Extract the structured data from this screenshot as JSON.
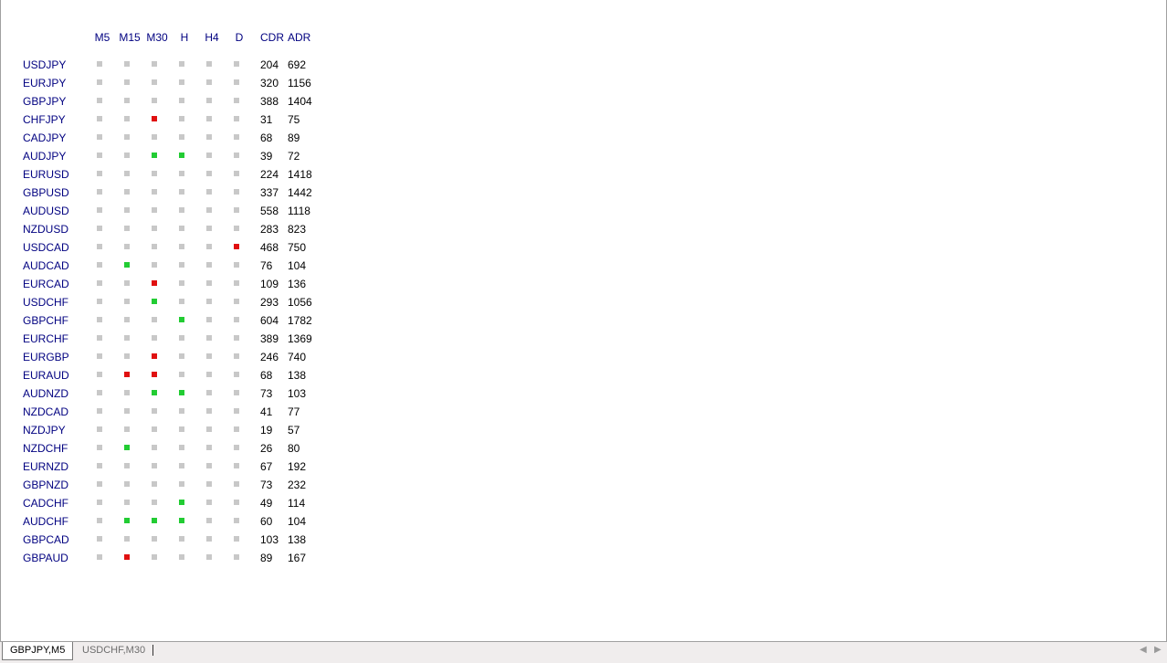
{
  "headers": {
    "timeframes": [
      "M5",
      "M15",
      "M30",
      "H",
      "H4",
      "D"
    ],
    "cdr": "CDR",
    "adr": "ADR"
  },
  "colors": {
    "grey": "#c8c8c8",
    "red": "#e01010",
    "green": "#22cc33"
  },
  "rows": [
    {
      "symbol": "USDJPY",
      "signals": [
        "g",
        "g",
        "g",
        "g",
        "g",
        "g"
      ],
      "cdr": "204",
      "adr": "692"
    },
    {
      "symbol": "EURJPY",
      "signals": [
        "g",
        "g",
        "g",
        "g",
        "g",
        "g"
      ],
      "cdr": "320",
      "adr": "1156"
    },
    {
      "symbol": "GBPJPY",
      "signals": [
        "g",
        "g",
        "g",
        "g",
        "g",
        "g"
      ],
      "cdr": "388",
      "adr": "1404"
    },
    {
      "symbol": "CHFJPY",
      "signals": [
        "g",
        "g",
        "r",
        "g",
        "g",
        "g"
      ],
      "cdr": "31",
      "adr": "75"
    },
    {
      "symbol": "CADJPY",
      "signals": [
        "g",
        "g",
        "g",
        "g",
        "g",
        "g"
      ],
      "cdr": "68",
      "adr": "89"
    },
    {
      "symbol": "AUDJPY",
      "signals": [
        "g",
        "g",
        "G",
        "G",
        "g",
        "g"
      ],
      "cdr": "39",
      "adr": "72"
    },
    {
      "symbol": "EURUSD",
      "signals": [
        "g",
        "g",
        "g",
        "g",
        "g",
        "g"
      ],
      "cdr": "224",
      "adr": "1418"
    },
    {
      "symbol": "GBPUSD",
      "signals": [
        "g",
        "g",
        "g",
        "g",
        "g",
        "g"
      ],
      "cdr": "337",
      "adr": "1442"
    },
    {
      "symbol": "AUDUSD",
      "signals": [
        "g",
        "g",
        "g",
        "g",
        "g",
        "g"
      ],
      "cdr": "558",
      "adr": "1118"
    },
    {
      "symbol": "NZDUSD",
      "signals": [
        "g",
        "g",
        "g",
        "g",
        "g",
        "g"
      ],
      "cdr": "283",
      "adr": "823"
    },
    {
      "symbol": "USDCAD",
      "signals": [
        "g",
        "g",
        "g",
        "g",
        "g",
        "r"
      ],
      "cdr": "468",
      "adr": "750"
    },
    {
      "symbol": "AUDCAD",
      "signals": [
        "g",
        "G",
        "g",
        "g",
        "g",
        "g"
      ],
      "cdr": "76",
      "adr": "104"
    },
    {
      "symbol": "EURCAD",
      "signals": [
        "g",
        "g",
        "r",
        "g",
        "g",
        "g"
      ],
      "cdr": "109",
      "adr": "136"
    },
    {
      "symbol": "USDCHF",
      "signals": [
        "g",
        "g",
        "G",
        "g",
        "g",
        "g"
      ],
      "cdr": "293",
      "adr": "1056"
    },
    {
      "symbol": "GBPCHF",
      "signals": [
        "g",
        "g",
        "g",
        "G",
        "g",
        "g"
      ],
      "cdr": "604",
      "adr": "1782"
    },
    {
      "symbol": "EURCHF",
      "signals": [
        "g",
        "g",
        "g",
        "g",
        "g",
        "g"
      ],
      "cdr": "389",
      "adr": "1369"
    },
    {
      "symbol": "EURGBP",
      "signals": [
        "g",
        "g",
        "r",
        "g",
        "g",
        "g"
      ],
      "cdr": "246",
      "adr": "740"
    },
    {
      "symbol": "EURAUD",
      "signals": [
        "g",
        "r",
        "r",
        "g",
        "g",
        "g"
      ],
      "cdr": "68",
      "adr": "138"
    },
    {
      "symbol": "AUDNZD",
      "signals": [
        "g",
        "g",
        "G",
        "G",
        "g",
        "g"
      ],
      "cdr": "73",
      "adr": "103"
    },
    {
      "symbol": "NZDCAD",
      "signals": [
        "g",
        "g",
        "g",
        "g",
        "g",
        "g"
      ],
      "cdr": "41",
      "adr": "77"
    },
    {
      "symbol": "NZDJPY",
      "signals": [
        "g",
        "g",
        "g",
        "g",
        "g",
        "g"
      ],
      "cdr": "19",
      "adr": "57"
    },
    {
      "symbol": "NZDCHF",
      "signals": [
        "g",
        "G",
        "g",
        "g",
        "g",
        "g"
      ],
      "cdr": "26",
      "adr": "80"
    },
    {
      "symbol": "EURNZD",
      "signals": [
        "g",
        "g",
        "g",
        "g",
        "g",
        "g"
      ],
      "cdr": "67",
      "adr": "192"
    },
    {
      "symbol": "GBPNZD",
      "signals": [
        "g",
        "g",
        "g",
        "g",
        "g",
        "g"
      ],
      "cdr": "73",
      "adr": "232"
    },
    {
      "symbol": "CADCHF",
      "signals": [
        "g",
        "g",
        "g",
        "G",
        "g",
        "g"
      ],
      "cdr": "49",
      "adr": "114"
    },
    {
      "symbol": "AUDCHF",
      "signals": [
        "g",
        "G",
        "G",
        "G",
        "g",
        "g"
      ],
      "cdr": "60",
      "adr": "104"
    },
    {
      "symbol": "GBPCAD",
      "signals": [
        "g",
        "g",
        "g",
        "g",
        "g",
        "g"
      ],
      "cdr": "103",
      "adr": "138"
    },
    {
      "symbol": "GBPAUD",
      "signals": [
        "g",
        "r",
        "g",
        "g",
        "g",
        "g"
      ],
      "cdr": "89",
      "adr": "167"
    }
  ],
  "tabs": [
    {
      "label": "GBPJPY,M5",
      "active": true
    },
    {
      "label": "USDCHF,M30",
      "active": false
    }
  ],
  "scroll_icons": {
    "left": "triangle-left-icon",
    "right": "triangle-right-icon"
  }
}
